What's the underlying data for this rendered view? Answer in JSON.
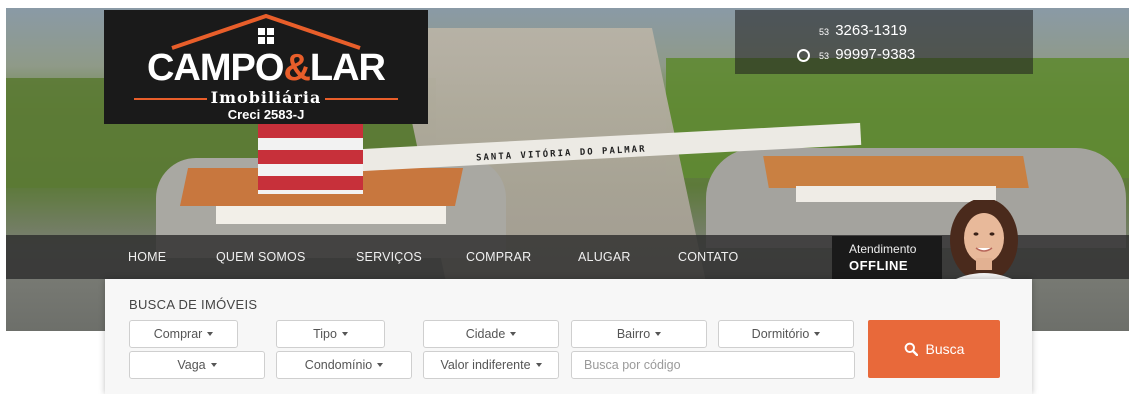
{
  "header": {
    "logo": {
      "name_part1": "CAMPO",
      "amp": "&",
      "name_part2": "LAR",
      "subtitle": "Imobiliária",
      "creci": "Creci 2583-J"
    },
    "phones": {
      "landline_ddd": "53",
      "landline_number": "3263-1319",
      "whatsapp_ddd": "53",
      "whatsapp_number": "99997-9383",
      "whatsapp_icon": "whatsapp-icon"
    },
    "banner_sign": "SANTA VITÓRIA DO PALMAR"
  },
  "nav": {
    "items": [
      {
        "label": "HOME"
      },
      {
        "label": "QUEM SOMOS"
      },
      {
        "label": "SERVIÇOS"
      },
      {
        "label": "COMPRAR"
      },
      {
        "label": "ALUGAR"
      },
      {
        "label": "CONTATO"
      }
    ],
    "atendimento": {
      "label": "Atendimento",
      "status": "OFFLINE"
    }
  },
  "search": {
    "title": "BUSCA DE IMÓVEIS",
    "row1": [
      {
        "label": "Comprar"
      },
      {
        "label": "Tipo"
      },
      {
        "label": "Cidade"
      },
      {
        "label": "Bairro"
      },
      {
        "label": "Dormitório"
      }
    ],
    "row2": [
      {
        "label": "Vaga"
      },
      {
        "label": "Condomínio"
      },
      {
        "label": "Valor indiferente"
      }
    ],
    "code_placeholder": "Busca por código",
    "button_label": "Busca",
    "button_icon": "search-icon"
  },
  "colors": {
    "accent": "#e8693a",
    "nav_bg": "#2d2d2d",
    "logo_bg": "#1a1a1a"
  }
}
